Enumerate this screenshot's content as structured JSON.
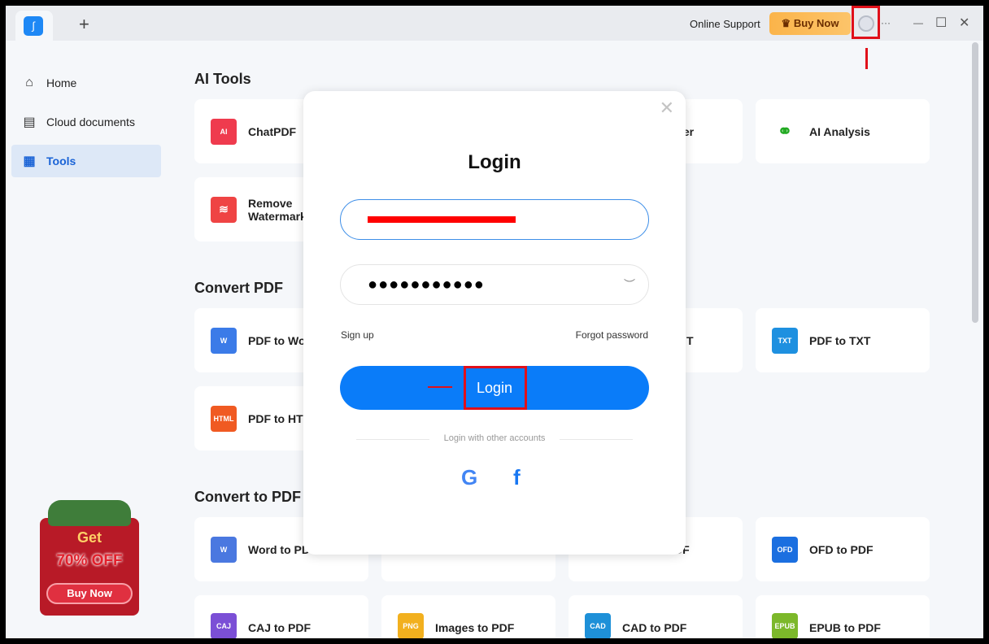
{
  "titlebar": {
    "new_tab": "+",
    "support": "Online Support",
    "buy_now": "Buy Now",
    "more": "···",
    "minimize": "—",
    "maximize": "☐",
    "close": "✕",
    "logo": "AI"
  },
  "sidebar": {
    "items": [
      {
        "label": "Home"
      },
      {
        "label": "Cloud documents"
      },
      {
        "label": "Tools"
      }
    ]
  },
  "promo": {
    "get": "Get",
    "discount": "70% OFF",
    "button": "Buy Now"
  },
  "sections": {
    "ai_tools": "AI Tools",
    "convert_pdf": "Convert PDF",
    "convert_to_pdf": "Convert to PDF"
  },
  "cards": {
    "chatpdf": "ChatPDF",
    "summarizer": "izer",
    "ai_analysis": "AI Analysis",
    "remove_watermark": "Remove Watermark",
    "pdf_to_word": "PDF to Word",
    "pdf_to_ppt": "T",
    "pdf_to_txt": "PDF to TXT",
    "pdf_to_html": "PDF to HTML",
    "word_to_pdf": "Word to PDF",
    "ppt_to_pdf": "DF",
    "ofd_to_pdf": "OFD to PDF",
    "caj_to_pdf": "CAJ to PDF",
    "images_to_pdf": "Images to PDF",
    "cad_to_pdf": "CAD to PDF",
    "epub_to_pdf": "EPUB to PDF"
  },
  "login": {
    "title": "Login",
    "password_mask": "●●●●●●●●●●●",
    "sign_up": "Sign up",
    "forgot": "Forgot password",
    "button": "Login",
    "other": "Login with other accounts",
    "google": "G",
    "facebook": "f"
  },
  "colors": {
    "accent": "#0a7cf9",
    "annotation": "#e0101a"
  }
}
